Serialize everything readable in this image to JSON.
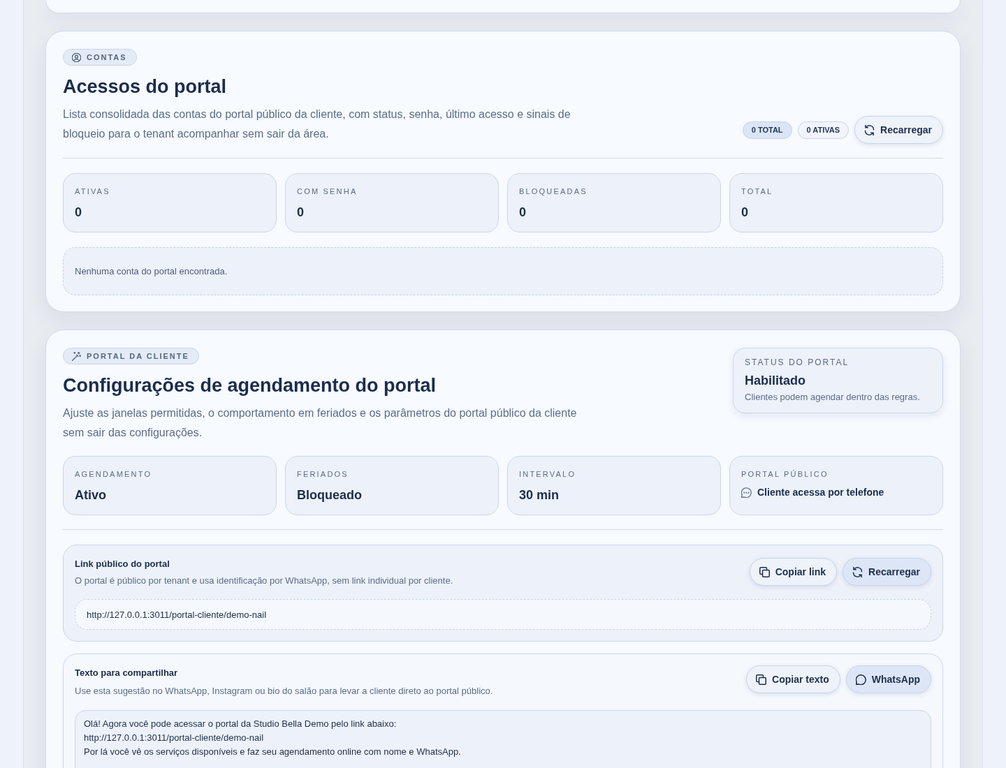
{
  "accounts": {
    "badge": "CONTAS",
    "title": "Acessos do portal",
    "description": "Lista consolidada das contas do portal público da cliente, com status, senha, último acesso e sinais de bloqueio para o tenant acompanhar sem sair da área.",
    "counts": [
      {
        "label": "0 TOTAL",
        "kind": "primary"
      },
      {
        "label": "0 ATIVAS",
        "kind": "neutral"
      }
    ],
    "reload_button": "Recarregar",
    "stats": [
      {
        "label": "ATIVAS",
        "value": "0"
      },
      {
        "label": "COM SENHA",
        "value": "0"
      },
      {
        "label": "BLOQUEADAS",
        "value": "0"
      },
      {
        "label": "TOTAL",
        "value": "0"
      }
    ],
    "empty_message": "Nenhuma conta do portal encontrada."
  },
  "portal_settings": {
    "badge": "PORTAL DA CLIENTE",
    "title": "Configurações de agendamento do portal",
    "description": "Ajuste as janelas permitidas, o comportamento em feriados e os parâmetros do portal público da cliente sem sair das configurações.",
    "status": {
      "label": "STATUS DO PORTAL",
      "value": "Habilitado",
      "note": "Clientes podem agendar dentro das regras."
    },
    "stats": [
      {
        "label": "AGENDAMENTO",
        "value": "Ativo",
        "kind": "value"
      },
      {
        "label": "FERIADOS",
        "value": "Bloqueado",
        "kind": "value"
      },
      {
        "label": "INTERVALO",
        "value": "30 min",
        "kind": "value"
      },
      {
        "label": "PORTAL PÚBLICO",
        "value": "Cliente acessa por telefone",
        "kind": "feature"
      }
    ],
    "link_section": {
      "title": "Link público do portal",
      "description": "O portal é público por tenant e usa identificação por WhatsApp, sem link individual por cliente.",
      "buttons": [
        {
          "label": "Copiar link",
          "kind": "secondary"
        },
        {
          "label": "Recarregar",
          "kind": "primary"
        }
      ],
      "url": "http://127.0.0.1:3011/portal-cliente/demo-nail"
    },
    "share_section": {
      "title": "Texto para compartilhar",
      "description": "Use esta sugestão no WhatsApp, Instagram ou bio do salão para levar a cliente direto ao portal público.",
      "buttons": [
        {
          "label": "Copiar texto",
          "kind": "secondary"
        },
        {
          "label": "WhatsApp",
          "kind": "primary"
        }
      ],
      "text": "Olá! Agora você pode acessar o portal da Studio Bella Demo pelo link abaixo:\nhttp://127.0.0.1:3011/portal-cliente/demo-nail\nPor lá você vê os serviços disponíveis e faz seu agendamento online com nome e WhatsApp."
    }
  }
}
